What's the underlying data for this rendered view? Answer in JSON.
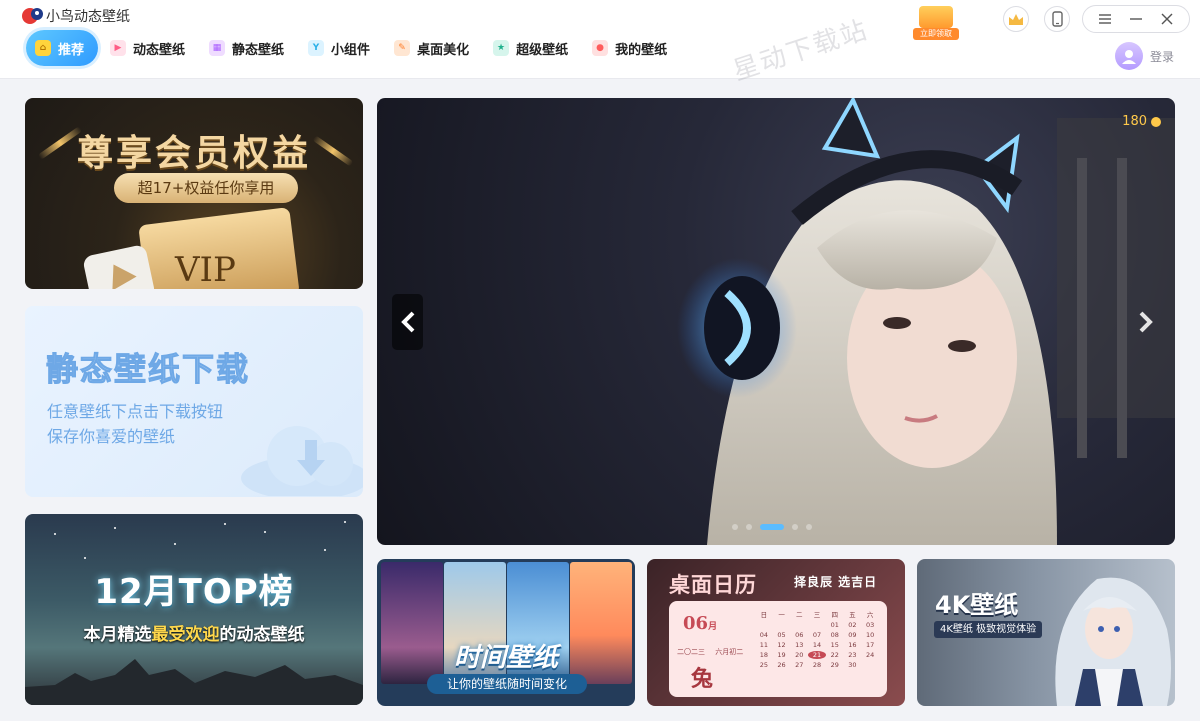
{
  "app": {
    "title": "小鸟动态壁纸",
    "watermark": "星动下载站",
    "promo_label": "立即领取",
    "login_label": "登录"
  },
  "nav": {
    "items": [
      {
        "label": "推荐",
        "icon": "home-icon",
        "color": "#ffd43c",
        "active": true
      },
      {
        "label": "动态壁纸",
        "icon": "play-icon",
        "color": "#ff7a9c"
      },
      {
        "label": "静态壁纸",
        "icon": "image-icon",
        "color": "#c58bff"
      },
      {
        "label": "小组件",
        "icon": "widget-icon",
        "color": "#56c5f0"
      },
      {
        "label": "桌面美化",
        "icon": "brush-icon",
        "color": "#ff9a4d"
      },
      {
        "label": "超级壁纸",
        "icon": "star-icon",
        "color": "#37c6a6"
      },
      {
        "label": "我的壁纸",
        "icon": "user-icon",
        "color": "#ff7f7f"
      }
    ]
  },
  "cards": {
    "vip": {
      "title": "尊享会员权益",
      "subtitle": "超17+权益任你享用",
      "ticket": "VIP"
    },
    "static": {
      "title": "静态壁纸下载",
      "line1": "任意壁纸下点击下载按钮",
      "line2": "保存你喜爱的壁纸"
    },
    "top": {
      "title": "12月TOP榜",
      "sub_pre": "本月精选",
      "sub_hl": "最受欢迎",
      "sub_post": "的动态壁纸"
    },
    "banner": {
      "coins": "180",
      "slide_count": 5,
      "active_slide": 2
    },
    "time": {
      "title": "时间壁纸",
      "subtitle": "让你的壁纸随时间变化"
    },
    "calendar": {
      "title": "桌面日历",
      "tag": "择良辰 选吉日",
      "month": "06",
      "month_unit": "月",
      "month_cn": "六月初二",
      "year_text": "二〇二三",
      "zodiac": "兔",
      "weekday_header": [
        "日",
        "一",
        "二",
        "三",
        "四",
        "五",
        "六"
      ],
      "days": [
        "",
        "",
        "",
        "",
        "01",
        "02",
        "03",
        "04",
        "05",
        "06",
        "07",
        "08",
        "09",
        "10",
        "11",
        "12",
        "13",
        "14",
        "15",
        "16",
        "17",
        "18",
        "19",
        "20",
        "21",
        "22",
        "23",
        "24",
        "25",
        "26",
        "27",
        "28",
        "29",
        "30",
        ""
      ],
      "today": "21"
    },
    "k4": {
      "title": "4K壁纸",
      "subtitle": "4K壁纸 极致视觉体验"
    }
  },
  "colors": {
    "accent": "#2f9bff",
    "banner_dot": "#5bbcff",
    "coin": "#ffc94a"
  }
}
